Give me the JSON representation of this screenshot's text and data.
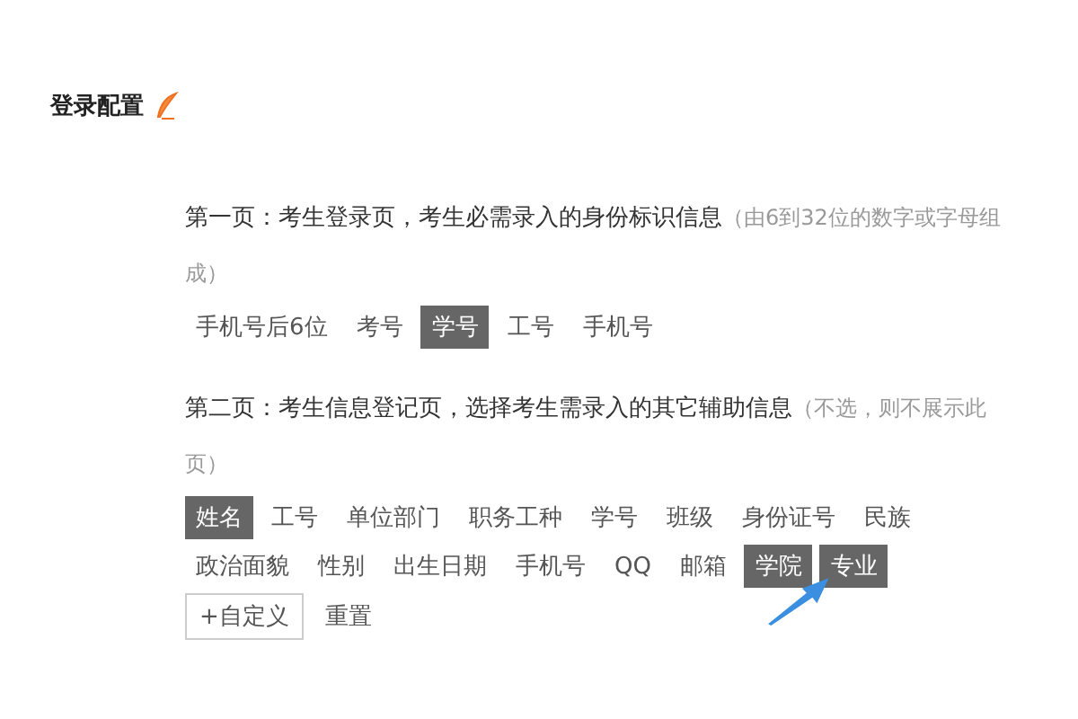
{
  "title": "登录配置",
  "sections": [
    {
      "text": "第一页：考生登录页，考生必需录入的身份标识信息",
      "note": "（由6到32位的数字或字母组成）",
      "tags": [
        {
          "label": "手机号后6位",
          "selected": false
        },
        {
          "label": "考号",
          "selected": false
        },
        {
          "label": "学号",
          "selected": true
        },
        {
          "label": "工号",
          "selected": false
        },
        {
          "label": "手机号",
          "selected": false
        }
      ]
    },
    {
      "text": "第二页：考生信息登记页，选择考生需录入的其它辅助信息",
      "note": "（不选，则不展示此页）",
      "tags": [
        {
          "label": "姓名",
          "selected": true
        },
        {
          "label": "工号",
          "selected": false
        },
        {
          "label": "单位部门",
          "selected": false
        },
        {
          "label": "职务工种",
          "selected": false
        },
        {
          "label": "学号",
          "selected": false
        },
        {
          "label": "班级",
          "selected": false
        },
        {
          "label": "身份证号",
          "selected": false
        },
        {
          "label": "民族",
          "selected": false
        },
        {
          "label": "政治面貌",
          "selected": false
        },
        {
          "label": "性别",
          "selected": false
        },
        {
          "label": "出生日期",
          "selected": false
        },
        {
          "label": "手机号",
          "selected": false
        },
        {
          "label": "QQ",
          "selected": false
        },
        {
          "label": "邮箱",
          "selected": false
        },
        {
          "label": "学院",
          "selected": true
        },
        {
          "label": "专业",
          "selected": true
        }
      ],
      "actions": [
        {
          "kind": "add",
          "label": "+自定义"
        },
        {
          "kind": "reset",
          "label": "重置"
        }
      ]
    }
  ]
}
